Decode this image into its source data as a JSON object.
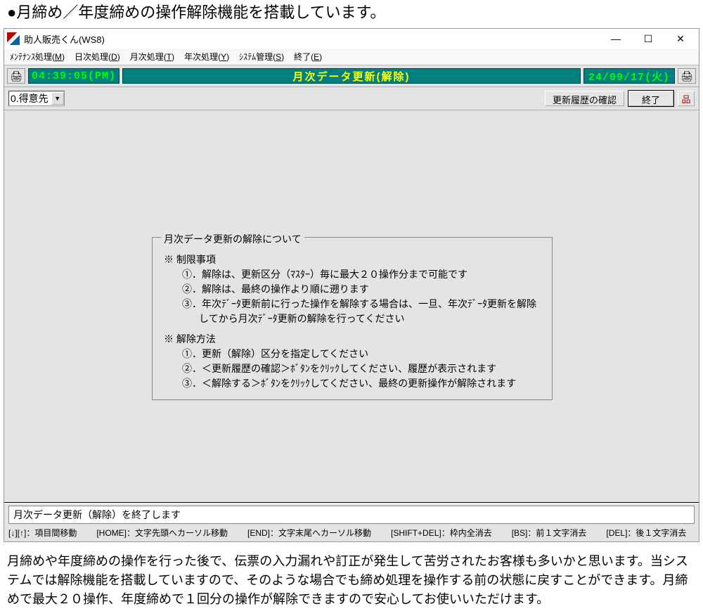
{
  "page_heading": "●月締め／年度締めの操作解除機能を搭載しています。",
  "window": {
    "title": "助人販売くん(WS8)",
    "buttons": {
      "min": "—",
      "max": "☐",
      "close": "✕"
    }
  },
  "menubar": [
    {
      "label": "ﾒﾝﾃﾅﾝｽ処理",
      "accel": "M"
    },
    {
      "label": "日次処理",
      "accel": "D"
    },
    {
      "label": "月次処理",
      "accel": "T"
    },
    {
      "label": "年次処理",
      "accel": "Y"
    },
    {
      "label": "ｼｽﾃﾑ管理",
      "accel": "S"
    },
    {
      "label": "終了",
      "accel": "E"
    }
  ],
  "info": {
    "time": "04:39:05(PM)",
    "title": "月次データ更新(解除)",
    "date": "24/09/17(火)"
  },
  "toolbar": {
    "dropdown_value": "0.得意先",
    "history_btn": "更新履歴の確認",
    "quit_btn": "終了"
  },
  "help": {
    "legend": "月次データ更新の解除について",
    "section1_head": "※ 制限事項",
    "section1_items": [
      "①．解除は、更新区分（ﾏｽﾀｰ）毎に最大２０操作分まで可能です",
      "②．解除は、最終の操作より順に遡ります",
      "③．年次ﾃﾞｰﾀ更新前に行った操作を解除する場合は、一旦、年次ﾃﾞｰﾀ更新を解除してから月次ﾃﾞｰﾀ更新の解除を行ってください"
    ],
    "section2_head": "※ 解除方法",
    "section2_items": [
      "①．更新（解除）区分を指定してください",
      "②．＜更新履歴の確認＞ﾎﾞﾀﾝをｸﾘｯｸしてください、履歴が表示されます",
      "③．＜解除する＞ﾎﾞﾀﾝをｸﾘｯｸしてください、最終の更新操作が解除されます"
    ]
  },
  "status": {
    "message": "月次データ更新（解除）を終了します",
    "hints": [
      "[↓][↑]：項目間移動",
      "[HOME]：文字先頭へカーソル移動",
      "[END]：文字末尾へカーソル移動",
      "[SHIFT+DEL]：枠内全消去",
      "[BS]：前１文字消去",
      "[DEL]：後１文字消去"
    ]
  },
  "footer": "月締めや年度締めの操作を行った後で、伝票の入力漏れや訂正が発生して苦労されたお客様も多いかと思います。当システムでは解除機能を搭載していますので、そのような場合でも締め処理を操作する前の状態に戻すことができます。月締めで最大２０操作、年度締めで１回分の操作が解除できますので安心してお使いいただけます。"
}
